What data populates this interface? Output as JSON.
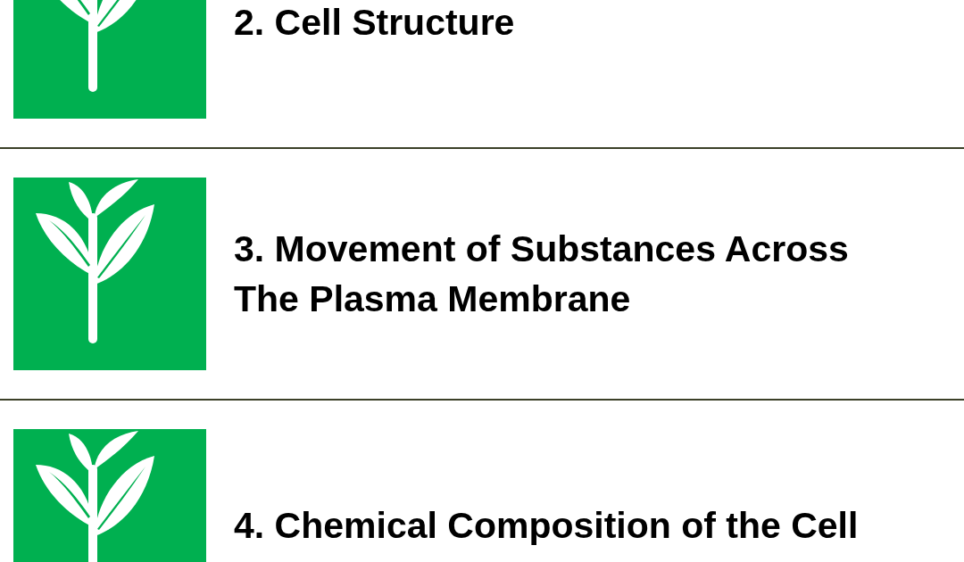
{
  "lessons": [
    {
      "title": "2. Cell Structure"
    },
    {
      "title": "3. Movement of Substances Across The Plasma Membrane"
    },
    {
      "title": "4. Chemical Composition of the Cell"
    }
  ]
}
